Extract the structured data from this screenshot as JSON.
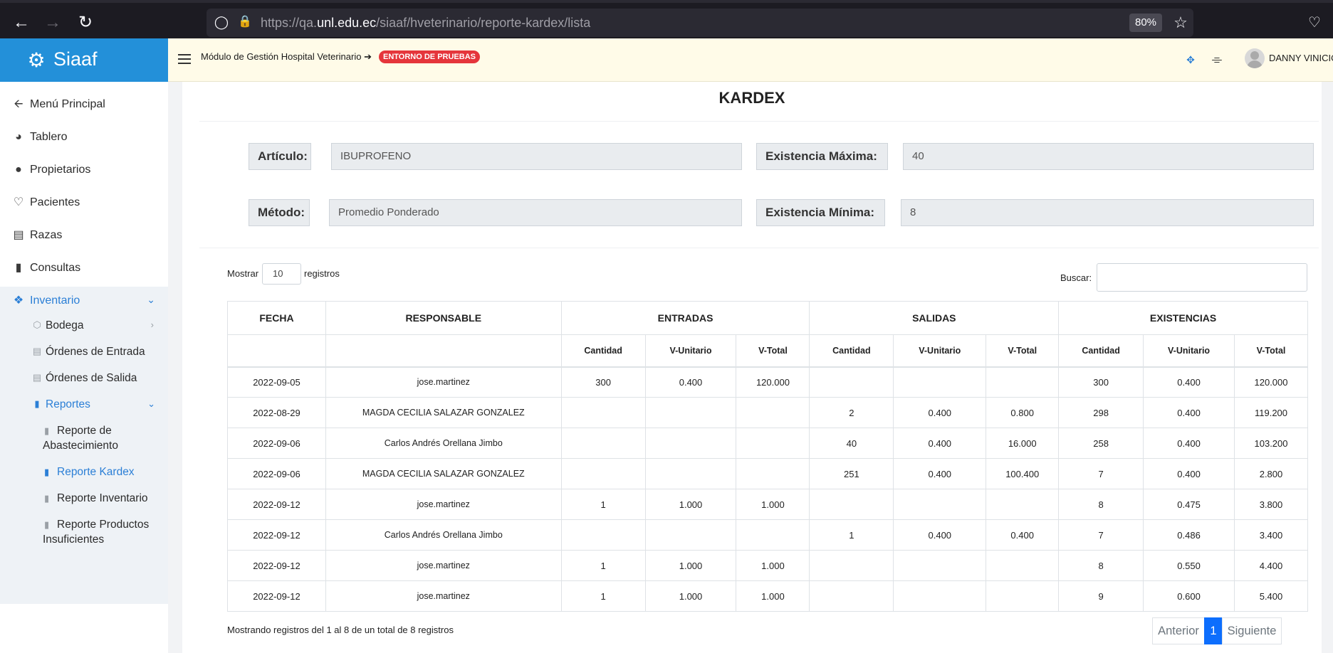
{
  "browser": {
    "url_prefix": "https://qa.",
    "url_domain": "unl.edu.ec",
    "url_path": "/siaaf/hveterinario/reporte-kardex/lista",
    "zoom": "80%"
  },
  "brand": {
    "name": "Siaaf",
    "color": "#2390d9"
  },
  "header": {
    "module": "Módulo de Gestión Hospital Veterinario",
    "arrow": "➔",
    "env_badge": "ENTORNO DE PRUEBAS",
    "user": "DANNY VINICIO"
  },
  "sidebar": {
    "items": [
      {
        "label": "Menú Principal",
        "icon": "arrow-left-icon"
      },
      {
        "label": "Tablero",
        "icon": "dashboard-icon"
      },
      {
        "label": "Propietarios",
        "icon": "users-icon"
      },
      {
        "label": "Pacientes",
        "icon": "heartbeat-icon"
      },
      {
        "label": "Razas",
        "icon": "list-icon"
      },
      {
        "label": "Consultas",
        "icon": "file-icon"
      },
      {
        "label": "Inventario",
        "icon": "boxes-icon"
      }
    ],
    "inventario_sub": [
      {
        "label": "Bodega",
        "icon": "cube-icon"
      },
      {
        "label": "Órdenes de Entrada",
        "icon": "list-alt-icon"
      },
      {
        "label": "Órdenes de Salida",
        "icon": "list-alt-icon"
      },
      {
        "label": "Reportes",
        "icon": "file-alt-icon"
      }
    ],
    "reportes_sub": [
      {
        "label": "Reporte de Abastecimiento"
      },
      {
        "label": "Reporte Kardex"
      },
      {
        "label": "Reporte Inventario"
      },
      {
        "label": "Reporte Productos Insuficientes"
      }
    ]
  },
  "page": {
    "title": "KARDEX",
    "articulo_label": "Artículo:",
    "articulo_value": "IBUPROFENO",
    "metodo_label": "Método:",
    "metodo_value": "Promedio Ponderado",
    "max_label": "Existencia Máxima:",
    "max_value": "40",
    "min_label": "Existencia Mínima:",
    "min_value": "8"
  },
  "table_controls": {
    "show_before": "Mostrar",
    "page_length": "10",
    "show_after": "registros",
    "search_label": "Buscar:",
    "search_value": ""
  },
  "table": {
    "group_headers": [
      "FECHA",
      "RESPONSABLE",
      "ENTRADAS",
      "SALIDAS",
      "EXISTENCIAS"
    ],
    "sub_headers": [
      "Cantidad",
      "V-Unitario",
      "V-Total",
      "Cantidad",
      "V-Unitario",
      "V-Total",
      "Cantidad",
      "V-Unitario",
      "V-Total"
    ],
    "rows": [
      [
        "2022-09-05",
        "jose.martinez",
        "300",
        "0.400",
        "120.000",
        "",
        "",
        "",
        "300",
        "0.400",
        "120.000"
      ],
      [
        "2022-08-29",
        "MAGDA CECILIA SALAZAR GONZALEZ",
        "",
        "",
        "",
        "2",
        "0.400",
        "0.800",
        "298",
        "0.400",
        "119.200"
      ],
      [
        "2022-09-06",
        "Carlos Andrés Orellana Jimbo",
        "",
        "",
        "",
        "40",
        "0.400",
        "16.000",
        "258",
        "0.400",
        "103.200"
      ],
      [
        "2022-09-06",
        "MAGDA CECILIA SALAZAR GONZALEZ",
        "",
        "",
        "",
        "251",
        "0.400",
        "100.400",
        "7",
        "0.400",
        "2.800"
      ],
      [
        "2022-09-12",
        "jose.martinez",
        "1",
        "1.000",
        "1.000",
        "",
        "",
        "",
        "8",
        "0.475",
        "3.800"
      ],
      [
        "2022-09-12",
        "Carlos Andrés Orellana Jimbo",
        "",
        "",
        "",
        "1",
        "0.400",
        "0.400",
        "7",
        "0.486",
        "3.400"
      ],
      [
        "2022-09-12",
        "jose.martinez",
        "1",
        "1.000",
        "1.000",
        "",
        "",
        "",
        "8",
        "0.550",
        "4.400"
      ],
      [
        "2022-09-12",
        "jose.martinez",
        "1",
        "1.000",
        "1.000",
        "",
        "",
        "",
        "9",
        "0.600",
        "5.400"
      ]
    ]
  },
  "footer": {
    "info": "Mostrando registros del 1 al 8 de un total de 8 registros",
    "prev": "Anterior",
    "current_page": "1",
    "next": "Siguiente"
  }
}
